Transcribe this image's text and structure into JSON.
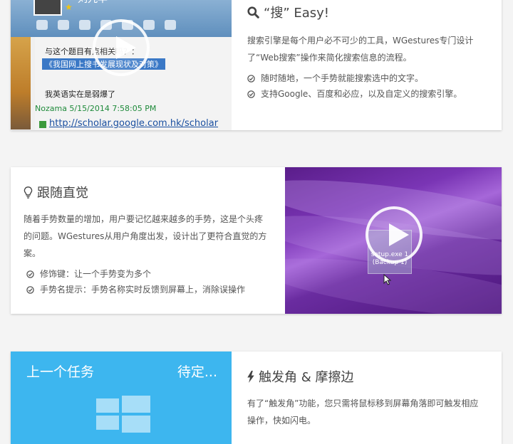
{
  "sections": [
    {
      "title": "“搜” Easy!",
      "icon": "search-icon",
      "description": "搜索引擎是每个用户必不可少的工具，WGestures专门设计了“Web搜索”操作来简化搜索信息的流程。",
      "features": [
        "随时随地，一个手势就能搜索选中的文字。",
        "支持Google、百度和必应，以及自定义的搜索引擎。"
      ],
      "media": {
        "name": "刘九丰",
        "line_partial": "与这个题目有点相关吗？：",
        "line_selected": "《我国网上搜书发展现状及对策》",
        "line_reply": "我英语实在是弱爆了",
        "meta": "Nozama 5/15/2014 7:58:05 PM",
        "link": "http://scholar.google.com.hk/scholar"
      }
    },
    {
      "title": "跟随直觉",
      "icon": "lightbulb-icon",
      "description": "随着手势数量的增加，用户要记忆越来越多的手势，这是个头疼的问题。WGestures从用户角度出发，设计出了更符合直觉的方案。",
      "features": [
        "修饰键：让一个手势变为多个",
        "手势名提示：手势名称实时反馈到屏幕上，消除误操作"
      ],
      "media": {
        "icon_label": "setup.exe 1 (Backup 1)"
      }
    },
    {
      "title": "触发角 & 摩擦边",
      "icon": "bolt-icon",
      "description": "有了“触发角”功能，您只需将鼠标移到屏幕角落即可触发相应操作，快如闪电。",
      "features": [],
      "media": {
        "left_label": "上一个任务",
        "right_label": "待定..."
      }
    }
  ],
  "colors": {
    "background": "#f4f4f4",
    "card": "#ffffff",
    "tile_blue": "#3db6ef",
    "purple": "#6a2ca0"
  }
}
